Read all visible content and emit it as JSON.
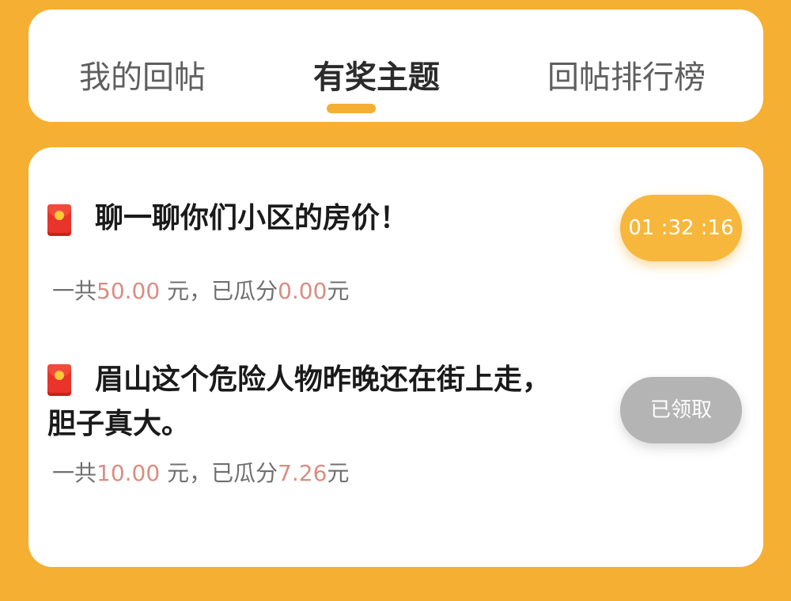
{
  "tabs": [
    {
      "label": "我的回帖",
      "active": false
    },
    {
      "label": "有奖主题",
      "active": true
    },
    {
      "label": "回帖排行榜",
      "active": false
    }
  ],
  "posts": [
    {
      "icon": "red-envelope-icon",
      "title": "聊一聊你们小区的房价！",
      "meta": {
        "prefix": "一共",
        "total": "50.00",
        "mid": " 元，已瓜分",
        "split": "0.00",
        "suffix": "元"
      },
      "action": {
        "type": "timer",
        "label": "01 :32 :16"
      }
    },
    {
      "icon": "red-envelope-icon",
      "title": "眉山这个危险人物昨晚还在街上走，胆子真大。",
      "meta": {
        "prefix": "一共",
        "total": "10.00",
        "mid": " 元，已瓜分",
        "split": "7.26",
        "suffix": "元"
      },
      "action": {
        "type": "claimed",
        "label": "已领取"
      }
    }
  ],
  "colors": {
    "background": "#F5AF32",
    "accent": "#F5AF32",
    "amount": "#D98D82",
    "claimed": "#B4B4B4",
    "envelope": "#E8342B"
  }
}
